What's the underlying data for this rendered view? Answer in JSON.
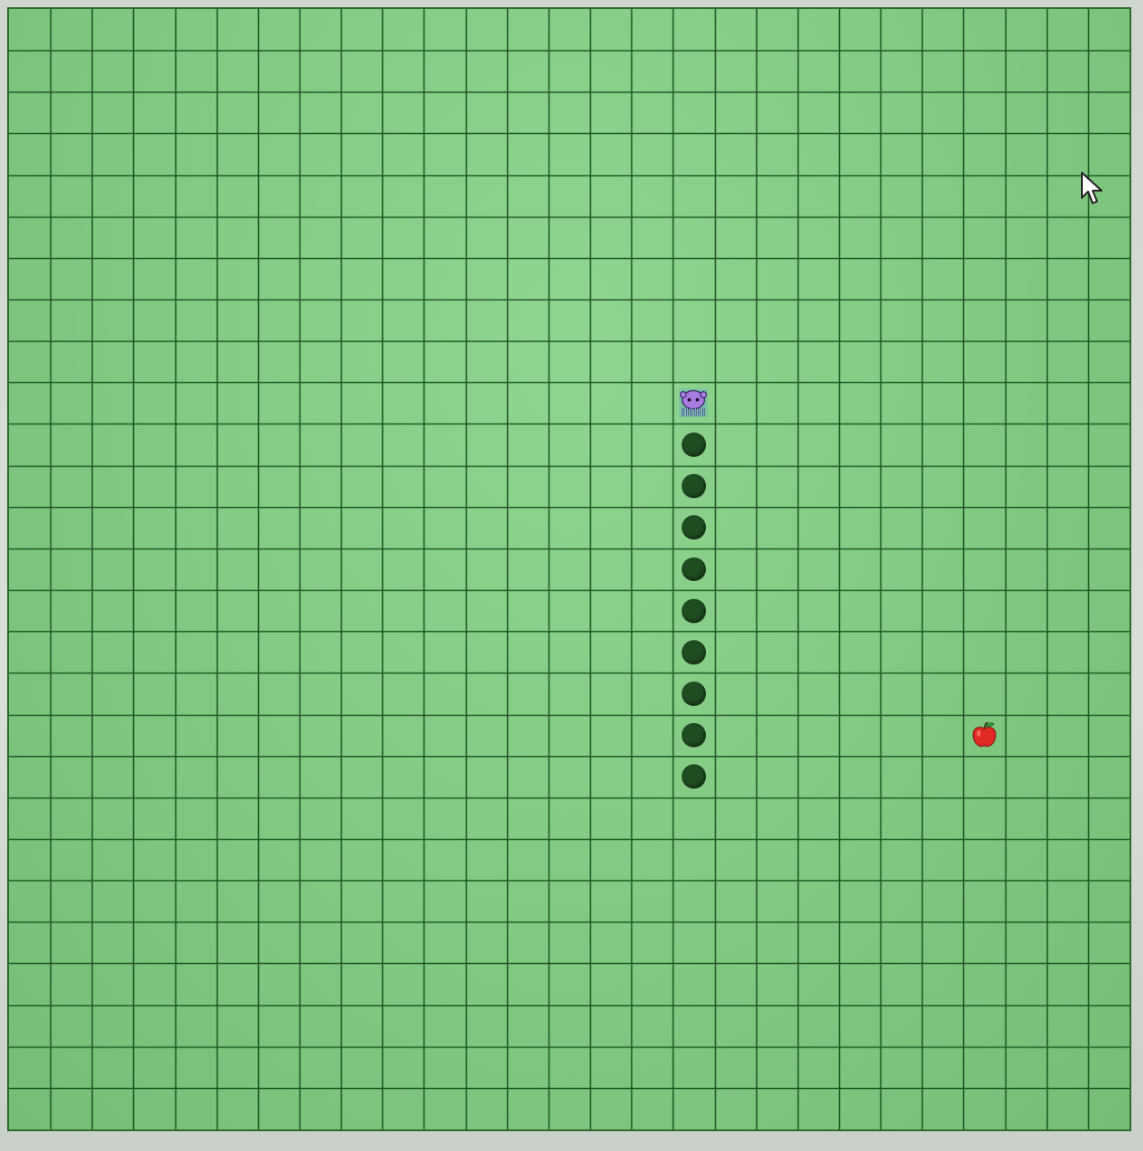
{
  "board": {
    "rows": 27,
    "cols": 27,
    "background_color": "#86cc86",
    "grid_line_color": "#1f5a24"
  },
  "snake": {
    "head_icon": "octopus-icon",
    "head_color": "#a77de0",
    "body_color": "#1f4d22",
    "cells": [
      [
        16,
        9
      ],
      [
        16,
        10
      ],
      [
        16,
        11
      ],
      [
        16,
        12
      ],
      [
        16,
        13
      ],
      [
        16,
        14
      ],
      [
        16,
        15
      ],
      [
        16,
        16
      ],
      [
        16,
        17
      ],
      [
        16,
        18
      ]
    ],
    "length": 10
  },
  "food": {
    "icon": "apple-icon",
    "color": "#e02a22",
    "cell": [
      23,
      17
    ]
  },
  "pointer": {
    "icon": "mouse-cursor-icon"
  }
}
